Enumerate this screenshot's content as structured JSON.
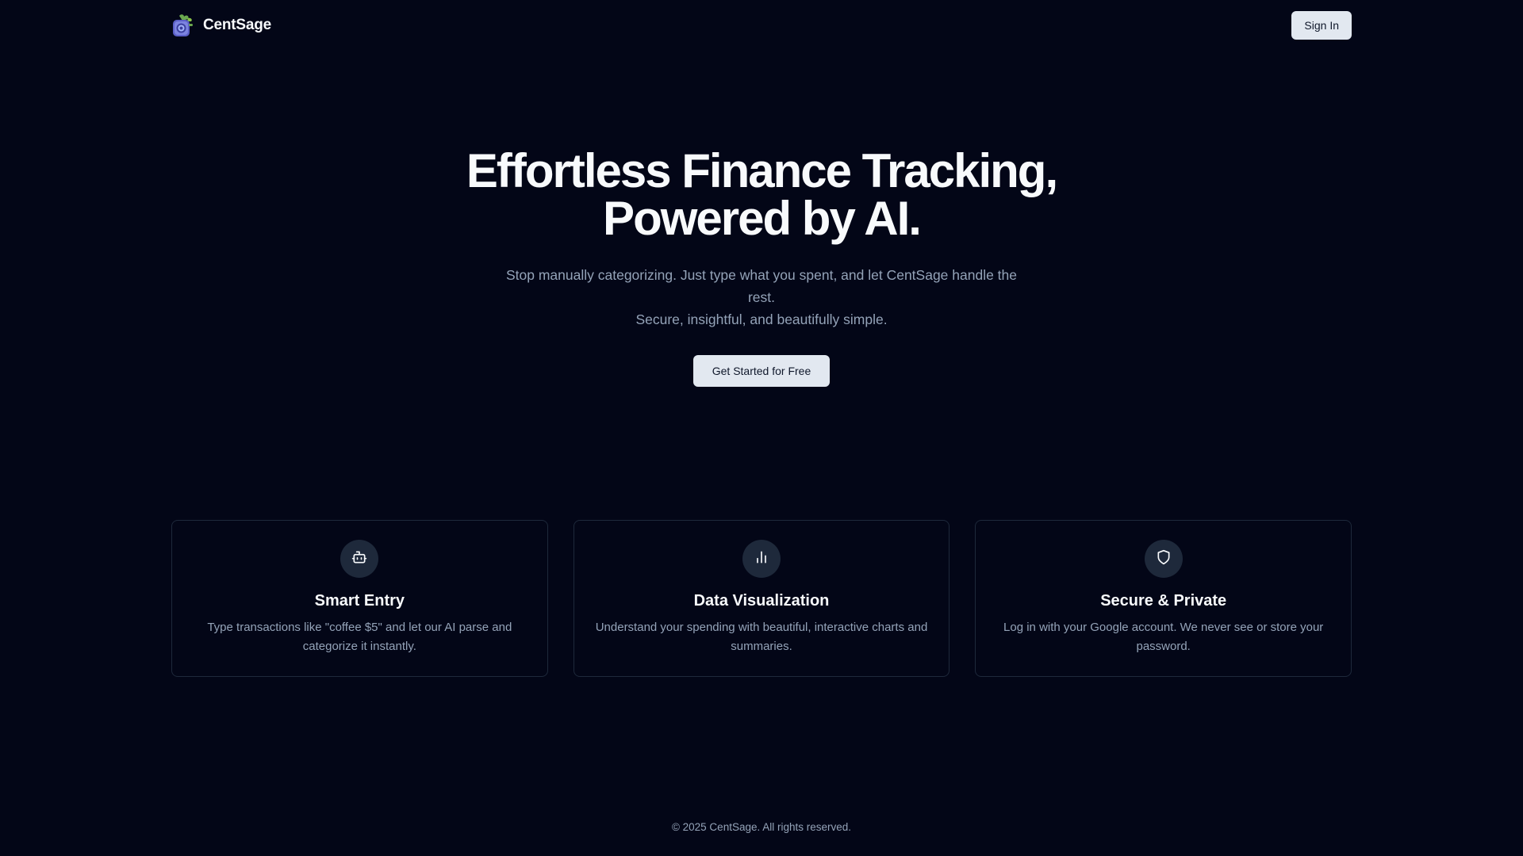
{
  "header": {
    "brand_name": "CentSage",
    "signin_label": "Sign In"
  },
  "hero": {
    "title_line1": "Effortless Finance Tracking,",
    "title_line2": "Powered by AI.",
    "subtitle_line1": "Stop manually categorizing. Just type what you spent, and let CentSage handle the rest.",
    "subtitle_line2": "Secure, insightful, and beautifully simple.",
    "cta_label": "Get Started for Free"
  },
  "features": [
    {
      "icon": "bot-icon",
      "title": "Smart Entry",
      "description": "Type transactions like \"coffee $5\" and let our AI parse and categorize it instantly."
    },
    {
      "icon": "bar-chart-icon",
      "title": "Data Visualization",
      "description": "Understand your spending with beautiful, interactive charts and summaries."
    },
    {
      "icon": "shield-icon",
      "title": "Secure & Private",
      "description": "Log in with your Google account. We never see or store your password."
    }
  ],
  "footer": {
    "copyright": "© 2025 CentSage. All rights reserved."
  },
  "colors": {
    "background": "#030617",
    "button_bg": "#e2e8f0",
    "muted_text": "#94a3b8",
    "card_border": "#1e293b"
  }
}
